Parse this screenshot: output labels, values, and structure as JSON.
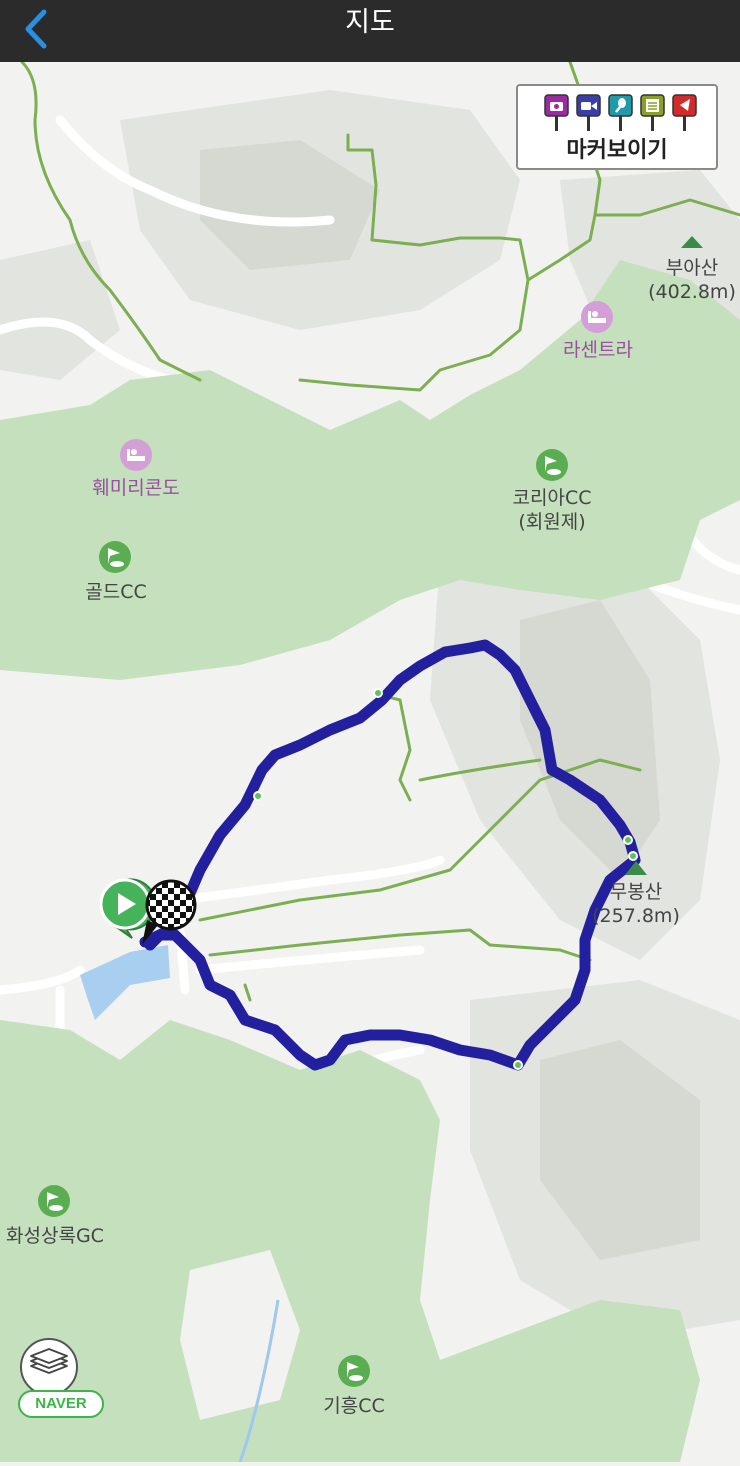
{
  "header": {
    "title": "지도"
  },
  "marker_panel": {
    "label": "마커보이기",
    "icons": [
      {
        "name": "camera-icon",
        "color": "#9c2aa0"
      },
      {
        "name": "video-icon",
        "color": "#3a3fa8"
      },
      {
        "name": "microphone-icon",
        "color": "#1e9aa8"
      },
      {
        "name": "memo-icon",
        "color": "#8aa02a"
      },
      {
        "name": "flag-icon",
        "color": "#d22b2b"
      }
    ]
  },
  "labels": {
    "buasan_name": "부아산",
    "buasan_height": "(402.8m)",
    "lasentra": "라센트라",
    "hwemiri": "훼미리콘도",
    "korea_cc_name": "코리아CC",
    "korea_cc_note": "(회원제)",
    "gold_cc": "골드CC",
    "mubongsan_name": "무봉산",
    "mubongsan_height": "(257.8m)",
    "hwaseong": "화성상록GC",
    "giheung": "기흥CC"
  },
  "map_brand": "NAVER",
  "colors": {
    "route": "#2320a0",
    "forest": "#c5e0bd",
    "header_bg": "#2b2b2b",
    "back_arrow": "#2a8fe0",
    "start_marker": "#44b35a"
  }
}
